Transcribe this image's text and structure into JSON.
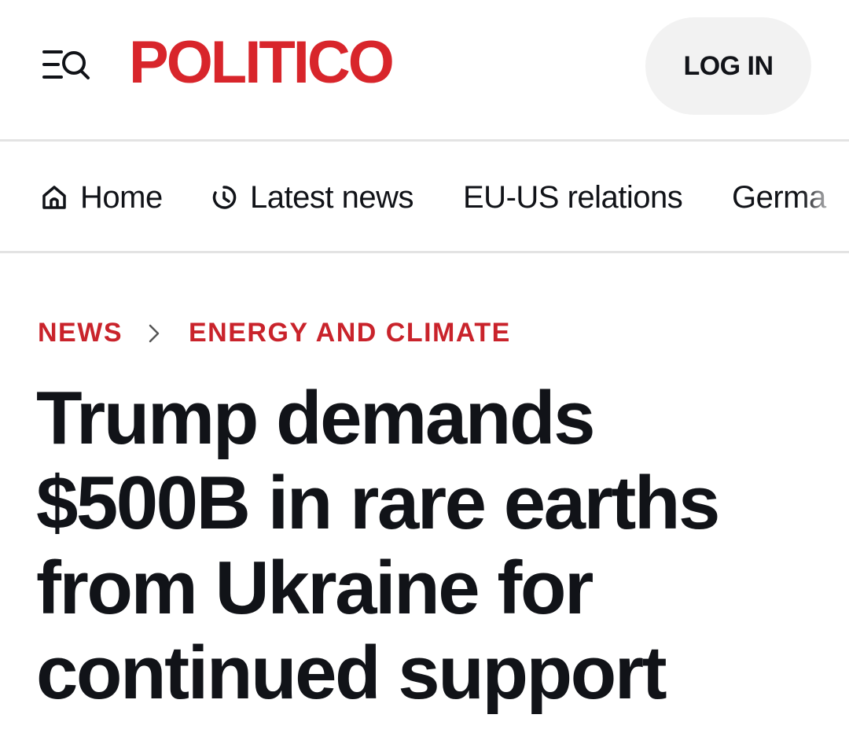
{
  "header": {
    "logo_text": "POLITICO",
    "login_label": "LOG IN",
    "menu_icon": "menu-search-icon",
    "brand_color": "#d8252b"
  },
  "nav": {
    "items": [
      {
        "label": "Home",
        "icon": "home-icon"
      },
      {
        "label": "Latest news",
        "icon": "clock-icon"
      },
      {
        "label": "EU-US relations"
      },
      {
        "label": "Germa"
      }
    ]
  },
  "breadcrumb": {
    "section": "NEWS",
    "subsection": "ENERGY AND CLIMATE",
    "color": "#c9232b"
  },
  "article": {
    "headline": "Trump demands $500B in rare earths from Ukraine for continued support"
  }
}
